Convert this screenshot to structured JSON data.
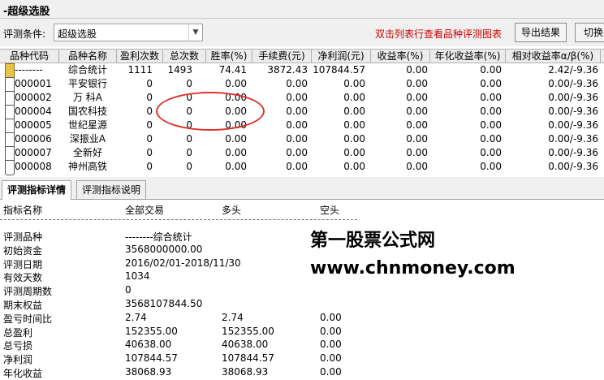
{
  "window": {
    "title": "-超级选股"
  },
  "toolbar": {
    "condition_label": "评测条件:",
    "condition_value": "超级选股",
    "hint": "双击列表行查看品种评测图表",
    "export_label": "导出结果",
    "switch_label": "切换"
  },
  "grid": {
    "columns": [
      "品种代码",
      "品种名称",
      "盈利次数",
      "总次数",
      "胜率(%)",
      "手续费(元)",
      "净利润(元)",
      "收益率(%)",
      "年化收益率(%)",
      "相对收益率α/β(%)"
    ],
    "rows": [
      [
        "--------",
        "综合统计",
        "1111",
        "1493",
        "74.41",
        "3872.43",
        "107844.57",
        "0.00",
        "0.00",
        "2.42/-9.36"
      ],
      [
        "000001",
        "平安银行",
        "0",
        "0",
        "0.00",
        "0.00",
        "0.00",
        "0.00",
        "0.00",
        "0.00/-9.36"
      ],
      [
        "000002",
        "万 科A",
        "0",
        "0",
        "0.00",
        "0.00",
        "0.00",
        "0.00",
        "0.00",
        "0.00/-9.36"
      ],
      [
        "000004",
        "国农科技",
        "0",
        "0",
        "0.00",
        "0.00",
        "0.00",
        "0.00",
        "0.00",
        "0.00/-9.36"
      ],
      [
        "000005",
        "世纪星源",
        "0",
        "0",
        "0.00",
        "0.00",
        "0.00",
        "0.00",
        "0.00",
        "0.00/-9.36"
      ],
      [
        "000006",
        "深振业A",
        "0",
        "0",
        "0.00",
        "0.00",
        "0.00",
        "0.00",
        "0.00",
        "0.00/-9.36"
      ],
      [
        "000007",
        "全新好",
        "0",
        "0",
        "0.00",
        "0.00",
        "0.00",
        "0.00",
        "0.00",
        "0.00/-9.36"
      ],
      [
        "000008",
        "神州高铁",
        "0",
        "0",
        "0.00",
        "0.00",
        "0.00",
        "0.00",
        "0.00",
        "0.00/-9.36"
      ]
    ]
  },
  "tabs": [
    "评测指标详情",
    "评测指标说明"
  ],
  "detail": {
    "headers": [
      "指标名称",
      "全部交易",
      "多头",
      "空头"
    ],
    "rows": [
      [
        "评测品种",
        "--------综合统计",
        "",
        ""
      ],
      [
        "初始资金",
        "3568000000.00",
        "",
        ""
      ],
      [
        "评测日期",
        "2016/02/01-2018/11/30",
        "",
        ""
      ],
      [
        "有效天数",
        "1034",
        "",
        ""
      ],
      [
        "评测周期数",
        "0",
        "",
        ""
      ],
      [
        "期末权益",
        "3568107844.50",
        "",
        ""
      ],
      [
        "盈亏时间比",
        "2.74",
        "2.74",
        "0.00"
      ],
      [
        "总盈利",
        "152355.00",
        "152355.00",
        "0.00"
      ],
      [
        "总亏损",
        "40638.00",
        "40638.00",
        "0.00"
      ],
      [
        "净利润",
        "107844.57",
        "107844.57",
        "0.00"
      ],
      [
        "年化收益",
        "38068.93",
        "38068.93",
        "0.00"
      ]
    ]
  },
  "watermark": {
    "line1": "第一股票公式网",
    "line2": "www.chnmoney.com"
  },
  "colors": {
    "hint": "#cc0000",
    "annotation": "#e0302a",
    "selected_icon": "#e8c44a"
  }
}
